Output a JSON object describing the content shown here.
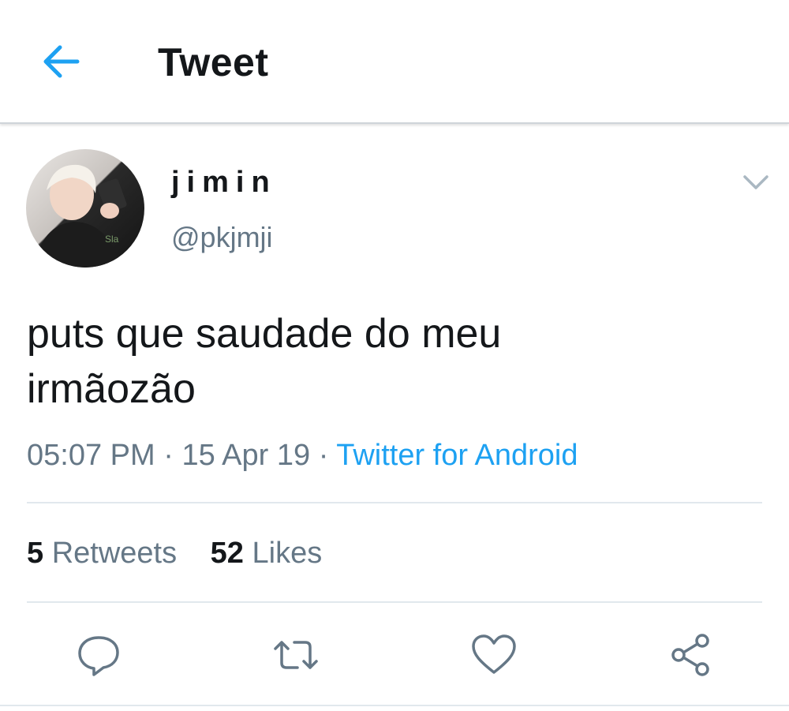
{
  "header": {
    "title": "Tweet",
    "back_icon": "arrow-left-icon",
    "accent_color": "#1da1f2"
  },
  "tweet": {
    "author": {
      "display_name": "jimin",
      "handle": "@pkjmji",
      "avatar": "profile-photo"
    },
    "text": "puts que saudade do meu\nirmãozão",
    "time": "05:07 PM",
    "date": "15 Apr 19",
    "separator": "·",
    "source": "Twitter for Android",
    "stats": {
      "retweets_count": "5",
      "retweets_label": "Retweets",
      "likes_count": "52",
      "likes_label": "Likes"
    },
    "actions": [
      {
        "name": "reply",
        "icon": "speech-bubble-icon"
      },
      {
        "name": "retweet",
        "icon": "retweet-arrows-icon"
      },
      {
        "name": "like",
        "icon": "heart-icon"
      },
      {
        "name": "share",
        "icon": "share-icon"
      }
    ]
  }
}
